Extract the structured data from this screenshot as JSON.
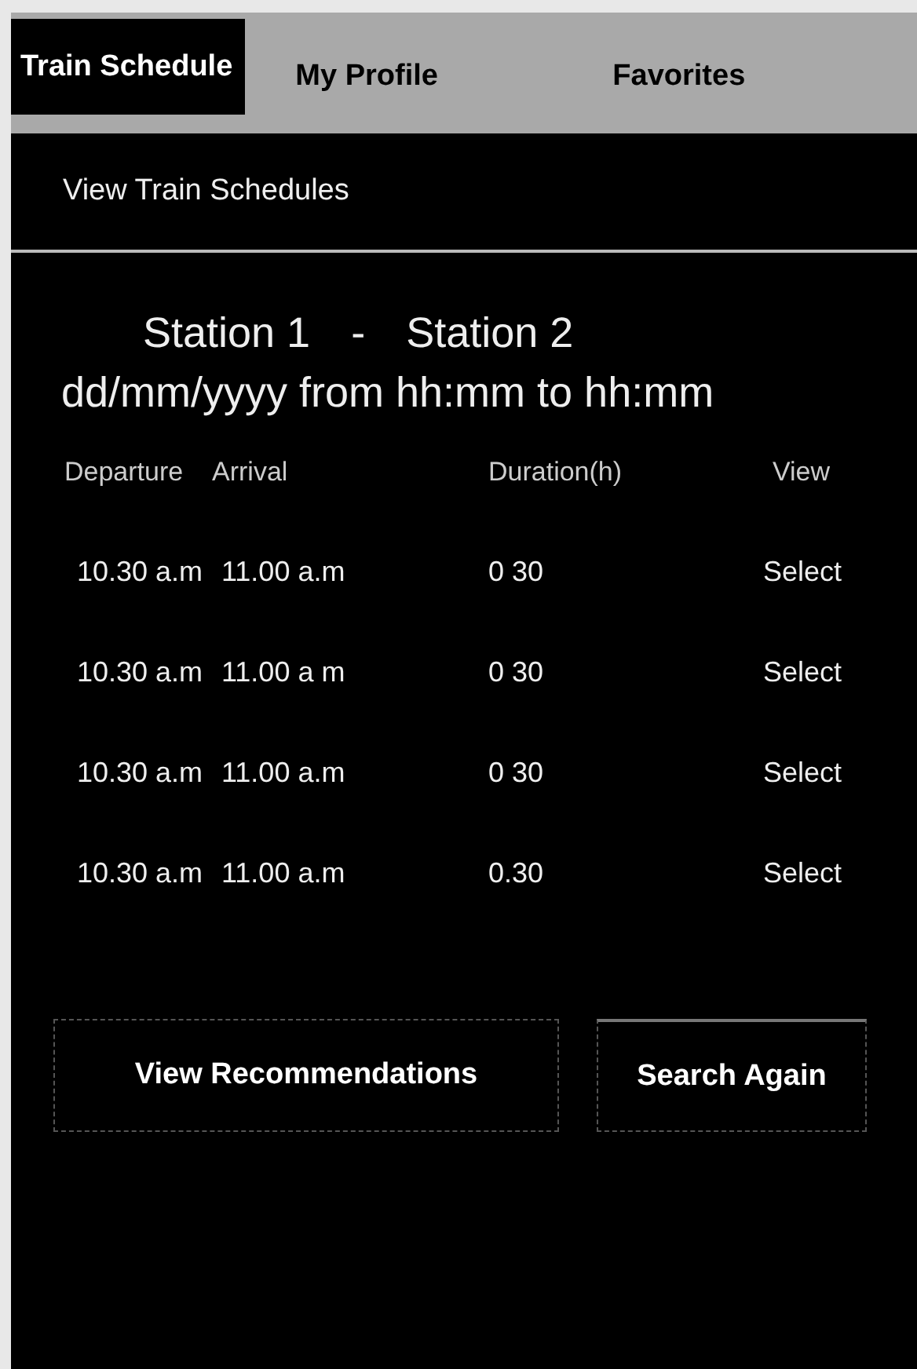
{
  "tabs": [
    {
      "label": "Train Schedule",
      "selected": true
    },
    {
      "label": "My Profile",
      "selected": false
    },
    {
      "label": "Favorites",
      "selected": false
    }
  ],
  "header": {
    "title": "View Train Schedules"
  },
  "route": {
    "from": "Station 1",
    "separator": "-",
    "to": "Station 2",
    "date_line": "dd/mm/yyyy from hh:mm to hh:mm"
  },
  "table": {
    "columns": [
      "Departure",
      "Arrival",
      "Duration(h)",
      "View"
    ],
    "rows": [
      {
        "departure": "10.30 a.m",
        "arrival": "11.00 a.m",
        "duration": "0 30",
        "action": "Select"
      },
      {
        "departure": "10.30 a.m",
        "arrival": "11.00 a m",
        "duration": "0 30",
        "action": "Select"
      },
      {
        "departure": "10.30 a.m",
        "arrival": "11.00 a.m",
        "duration": "0 30",
        "action": "Select"
      },
      {
        "departure": "10.30 a.m",
        "arrival": "11.00 a.m",
        "duration": "0.30",
        "action": "Select"
      }
    ]
  },
  "buttons": [
    "View Recommendations",
    "Search Again"
  ]
}
